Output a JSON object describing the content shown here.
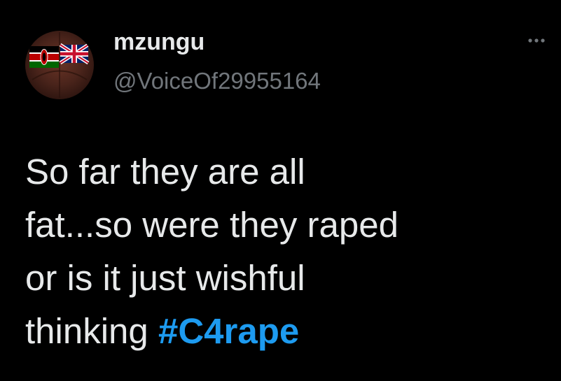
{
  "tweet": {
    "author": {
      "display_name": "mzungu",
      "handle": "@VoiceOf29955164",
      "avatar_icon": "kenya-uk-flags-avatar"
    },
    "more_icon": "more-horizontal-icon",
    "text_lines": [
      "So far they are all",
      "fat...so were they raped",
      "or is it just wishful",
      "thinking "
    ],
    "hashtag": "#C4rape"
  },
  "colors": {
    "background": "#000000",
    "text": "#e7e9ea",
    "secondary_text": "#71767b",
    "link": "#1d9bf0"
  }
}
